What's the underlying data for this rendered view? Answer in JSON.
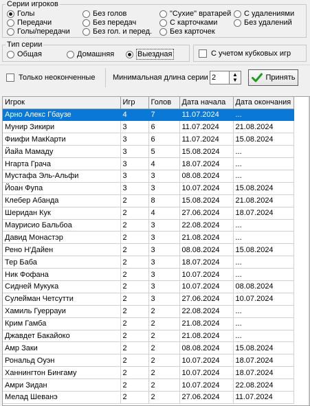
{
  "series_group": {
    "legend": "Серии игроков",
    "options": [
      {
        "label": "Голы",
        "selected": true
      },
      {
        "label": "Передачи",
        "selected": false
      },
      {
        "label": "Голы/передачи",
        "selected": false
      },
      {
        "label": "Без голов",
        "selected": false
      },
      {
        "label": "Без передач",
        "selected": false
      },
      {
        "label": "Без гол. и перед.",
        "selected": false
      },
      {
        "label": "\"Сухие\" вратарей",
        "selected": false
      },
      {
        "label": "С карточками",
        "selected": false
      },
      {
        "label": "Без карточек",
        "selected": false
      },
      {
        "label": "С удалениями",
        "selected": false
      },
      {
        "label": "Без удалений",
        "selected": false
      }
    ]
  },
  "type_group": {
    "legend": "Тип серии",
    "options": [
      {
        "label": "Общая",
        "selected": false
      },
      {
        "label": "Домашняя",
        "selected": false
      },
      {
        "label": "Выездная",
        "selected": true
      }
    ]
  },
  "cup_checkbox": {
    "label": "С учетом кубковых игр",
    "checked": false
  },
  "unfinished_checkbox": {
    "label": "Только неоконченные",
    "checked": false
  },
  "min_length": {
    "label": "Минимальная длина серии",
    "value": "2"
  },
  "accept_button": {
    "label": "Принять",
    "icon": "checkmark-icon"
  },
  "table": {
    "columns": [
      "Игрок",
      "Игр",
      "Голов",
      "Дата начала",
      "Дата окончания"
    ],
    "rows": [
      [
        "Арно Алекс Гбаузе",
        "4",
        "7",
        "11.07.2024",
        "..."
      ],
      [
        "Мунир Зикири",
        "3",
        "6",
        "11.07.2024",
        "21.08.2024"
      ],
      [
        "Фиифи МакКарти",
        "3",
        "6",
        "11.07.2024",
        "15.08.2024"
      ],
      [
        "Йайа Мамаду",
        "3",
        "5",
        "15.08.2024",
        "..."
      ],
      [
        "Нгарта Грача",
        "3",
        "4",
        "18.07.2024",
        "..."
      ],
      [
        "Мустафа Эль-Альфи",
        "3",
        "3",
        "08.08.2024",
        "..."
      ],
      [
        "Йоан Фупа",
        "3",
        "3",
        "10.07.2024",
        "15.08.2024"
      ],
      [
        "Клебер Абанда",
        "2",
        "8",
        "15.08.2024",
        "21.08.2024"
      ],
      [
        "Шеридан Кук",
        "2",
        "4",
        "27.06.2024",
        "18.07.2024"
      ],
      [
        "Маурисио Бальбоа",
        "2",
        "3",
        "22.08.2024",
        "..."
      ],
      [
        "Давид Монастэр",
        "2",
        "3",
        "21.08.2024",
        "..."
      ],
      [
        "Рено Н'Дайен",
        "2",
        "3",
        "08.08.2024",
        "15.08.2024"
      ],
      [
        "Тер Баба",
        "2",
        "3",
        "18.07.2024",
        "..."
      ],
      [
        "Ник Фофана",
        "2",
        "3",
        "10.07.2024",
        "..."
      ],
      [
        "Сидней Мукука",
        "2",
        "3",
        "10.07.2024",
        "08.08.2024"
      ],
      [
        "Сулейман Четсутти",
        "2",
        "3",
        "27.06.2024",
        "10.07.2024"
      ],
      [
        "Хамиль Гуеррауи",
        "2",
        "2",
        "22.08.2024",
        "..."
      ],
      [
        "Крим Гамба",
        "2",
        "2",
        "21.08.2024",
        "..."
      ],
      [
        "Джавдет Бакайоко",
        "2",
        "2",
        "21.08.2024",
        "..."
      ],
      [
        "Амр Заки",
        "2",
        "2",
        "08.08.2024",
        "15.08.2024"
      ],
      [
        "Рональд Оуэн",
        "2",
        "2",
        "10.07.2024",
        "18.07.2024"
      ],
      [
        "Ханнингтон Бингаму",
        "2",
        "2",
        "10.07.2024",
        "18.07.2024"
      ],
      [
        "Амри Зидан",
        "2",
        "2",
        "10.07.2024",
        "22.08.2024"
      ],
      [
        "Мелад Шеванэ",
        "2",
        "2",
        "27.06.2024",
        "11.07.2024"
      ]
    ],
    "selected_row": 0
  }
}
